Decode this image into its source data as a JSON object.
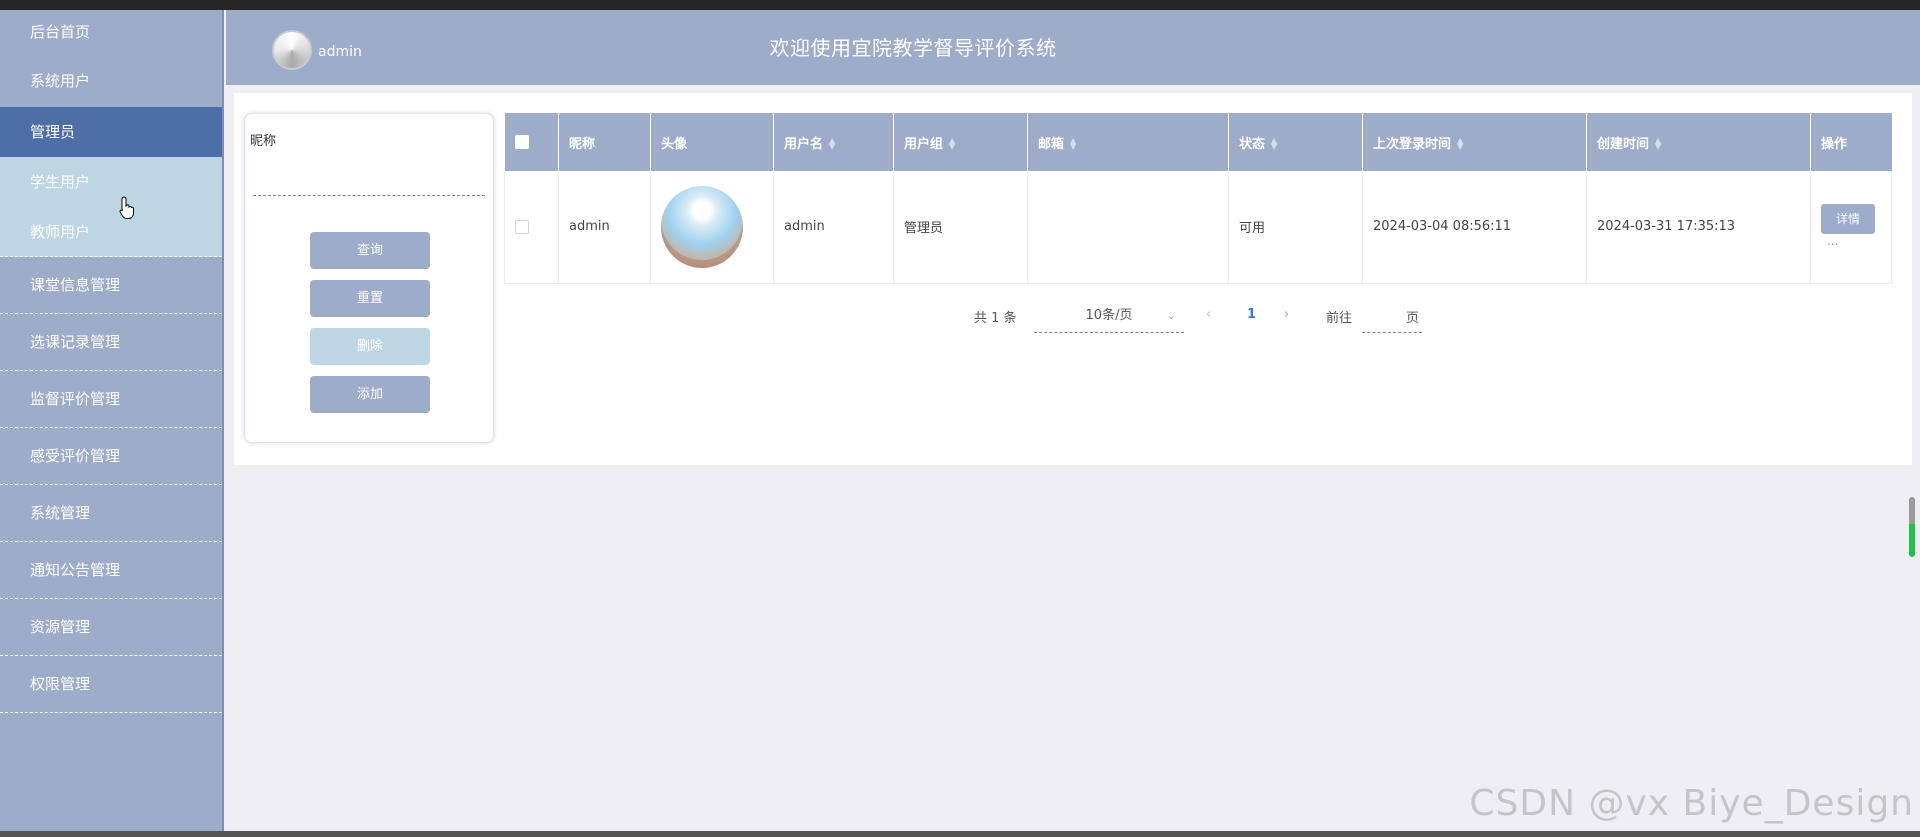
{
  "header": {
    "admin_name": "admin",
    "title": "欢迎使用宜院教学督导评价系统"
  },
  "sidebar": {
    "items": [
      {
        "label": "后台首页"
      },
      {
        "label": "系统用户"
      },
      {
        "label": "管理员"
      },
      {
        "label": "学生用户"
      },
      {
        "label": "教师用户"
      },
      {
        "label": "课堂信息管理"
      },
      {
        "label": "选课记录管理"
      },
      {
        "label": "监督评价管理"
      },
      {
        "label": "感受评价管理"
      },
      {
        "label": "系统管理"
      },
      {
        "label": "通知公告管理"
      },
      {
        "label": "资源管理"
      },
      {
        "label": "权限管理"
      }
    ]
  },
  "search": {
    "label": "昵称",
    "value": "",
    "buttons": {
      "query": "查询",
      "reset": "重置",
      "delete": "删除",
      "add": "添加"
    }
  },
  "table": {
    "headers": [
      "昵称",
      "头像",
      "用户名",
      "用户组",
      "邮箱",
      "状态",
      "上次登录时间",
      "创建时间",
      "操作"
    ],
    "rows": [
      {
        "nickname": "admin",
        "username": "admin",
        "group": "管理员",
        "email": "",
        "status": "可用",
        "last_login": "2024-03-04 08:56:11",
        "created": "2024-03-31 17:35:13",
        "action": "详情",
        "more": "..."
      }
    ]
  },
  "pagination": {
    "total": "共 1 条",
    "page_size": "10条/页",
    "current_page": "1",
    "goto_label": "前往",
    "page_suffix": "页",
    "goto_value": ""
  },
  "watermark": "CSDN @vx  Biye_Design",
  "colors": {
    "sidebar_bg": "#9dacc9",
    "active_item": "#4d6ea6",
    "submenu_bg": "#bdd6e4",
    "accent": "#3a7bd5"
  },
  "icons": {
    "avatar": "loading-spinner-avatar",
    "cursor": "hand-pointer-icon",
    "prev": "chevron-left-icon",
    "next": "chevron-right-icon",
    "dropdown": "chevron-down-icon",
    "sort": "sort-icon"
  }
}
